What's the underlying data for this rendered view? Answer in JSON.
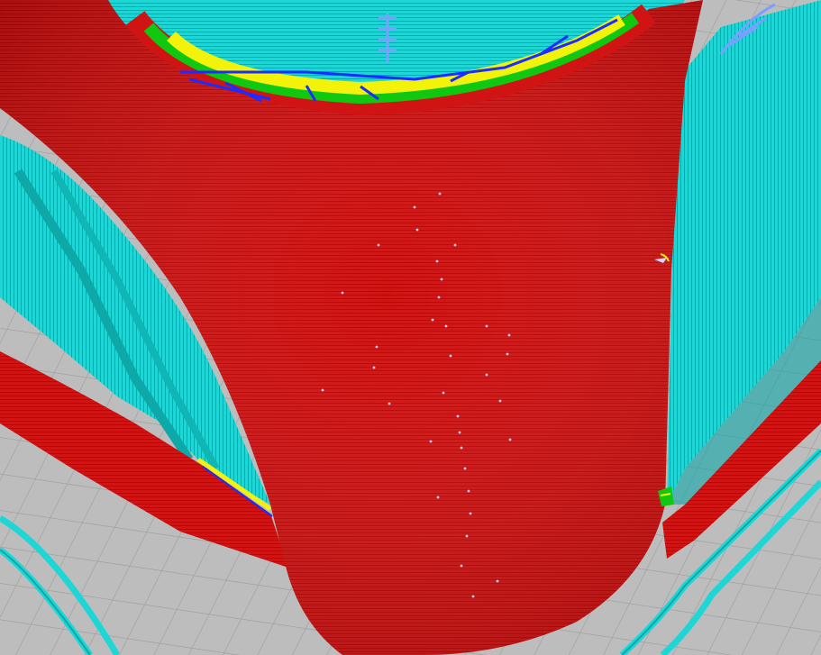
{
  "view": {
    "kind": "3d-printing-slicer-gcode-preview",
    "colors": {
      "bed_background": "#bdbdbd",
      "bed_grid_line": "#9a9a9a",
      "outer_wall": "#d01414",
      "outer_wall_dark": "#a50f0f",
      "inner_wall": "#1fd6d6",
      "inner_wall_dark": "#0fa8a8",
      "skin": "#f2f20a",
      "infill_green": "#10c810",
      "travel_line": "#1a2cff",
      "seam_marker": "#d8d0ff",
      "support_blue": "#7aa0ff"
    }
  }
}
